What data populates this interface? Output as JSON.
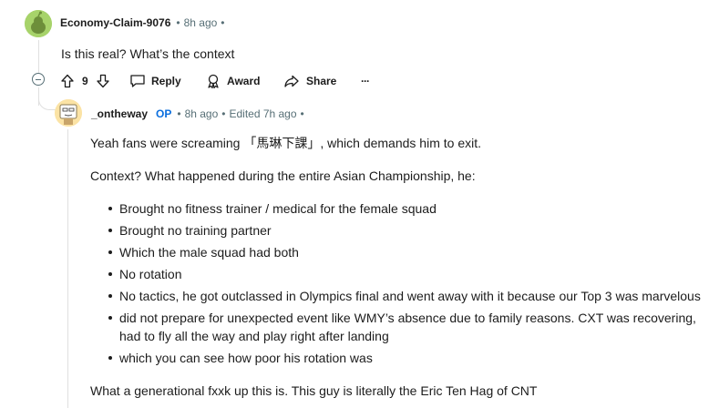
{
  "comment": {
    "username": "Economy-Claim-9076",
    "time": "8h ago",
    "sep": "•",
    "body": "Is this real? What’s the context",
    "votes": "9",
    "actions": {
      "reply": "Reply",
      "award": "Award",
      "share": "Share",
      "more": "···"
    }
  },
  "reply": {
    "username": "_ontheway",
    "op": "OP",
    "time": "8h ago",
    "edited": "Edited 7h ago",
    "sep": "•",
    "para1": "Yeah fans were screaming 「馬琳下課」, which demands him to exit.",
    "para2": "Context? What happened during the entire Asian Championship, he:",
    "bullets": [
      "Brought no fitness trainer / medical for the female squad",
      "Brought no training partner",
      "Which the male squad had both",
      "No rotation",
      "No tactics, he got outclassed in Olympics final and went away with it because our Top 3 was marvelous",
      "did not prepare for unexpected event like WMY’s absence due to family reasons. CXT was recovering, had to fly all the way and play right after landing",
      "which you can see how poor his rotation was"
    ],
    "para3": "What a generational fxxk up this is. This guy is literally the Eric Ten Hag of CNT"
  },
  "colors": {
    "text": "#1c1c1c",
    "meta": "#576f76",
    "op": "#0a6ede",
    "avatar1_bg": "#a7d36a",
    "avatar2_bg": "#fbe3a5",
    "thread": "#e0e0e0"
  }
}
